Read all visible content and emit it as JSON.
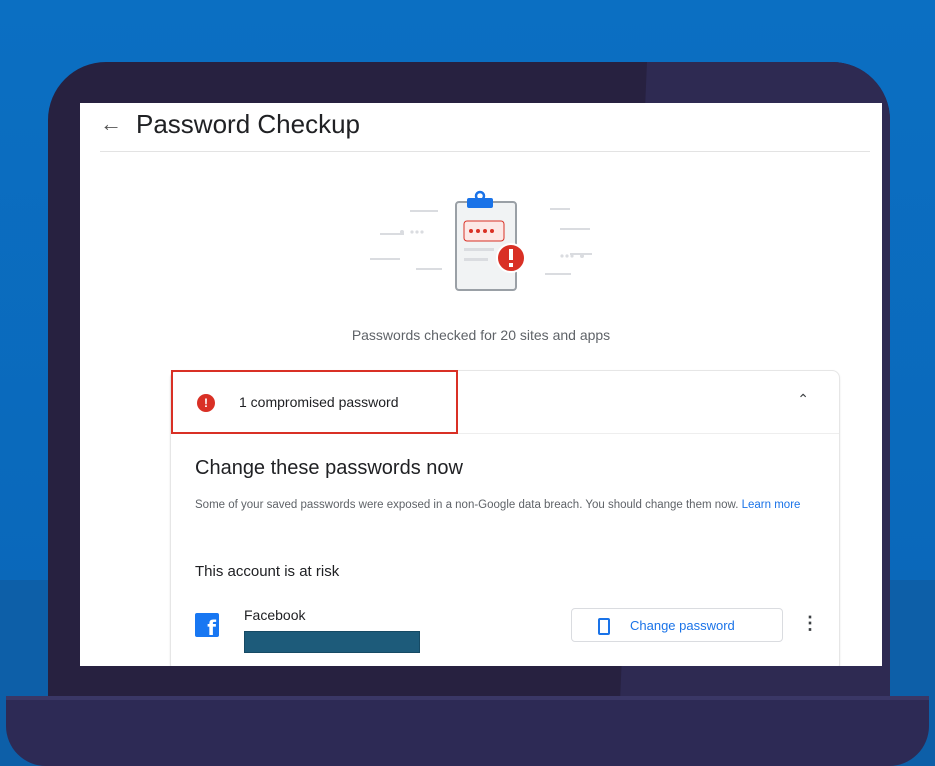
{
  "header": {
    "title": "Password Checkup"
  },
  "summary": {
    "checked_text": "Passwords checked for 20 sites and apps"
  },
  "card": {
    "alert_count_label": "1 compromised password",
    "heading": "Change these passwords now",
    "description": "Some of your saved passwords were exposed in a non-Google data breach. You should change them now.",
    "learn_more": "Learn more",
    "risk_label": "This account is at risk",
    "account": {
      "site": "Facebook",
      "action_label": "Change password"
    }
  },
  "icons": {
    "back": "back-arrow-icon",
    "alert": "alert-icon",
    "collapse": "chevron-up-icon",
    "facebook": "facebook-icon",
    "device": "phone-icon",
    "more": "more-vert-icon"
  },
  "colors": {
    "accent": "#1a73e8",
    "alert": "#d93025",
    "background": "#0b6fc2",
    "laptop": "#272140"
  }
}
